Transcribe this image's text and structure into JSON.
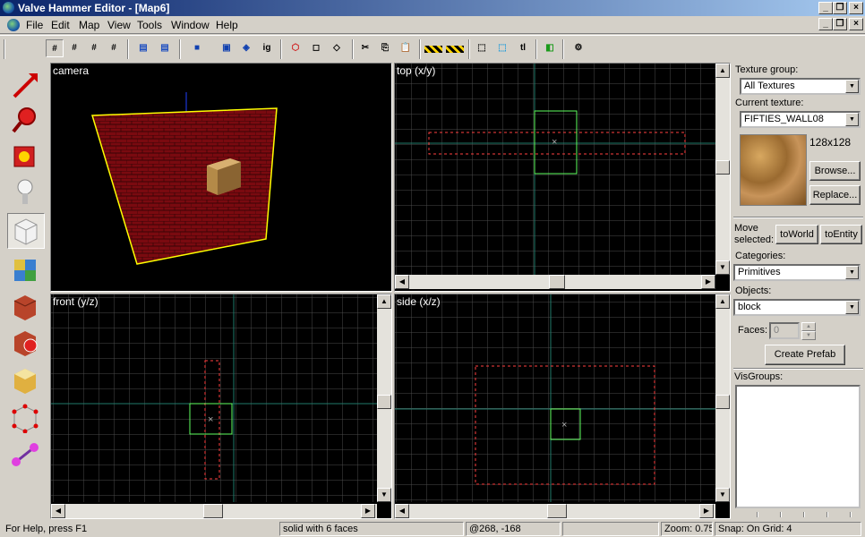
{
  "window": {
    "title": "Valve Hammer Editor - [Map6]"
  },
  "menu": [
    "File",
    "Edit",
    "Map",
    "View",
    "Tools",
    "Window",
    "Help"
  ],
  "toolbar": {
    "ig_label": "ig",
    "tl_label": "tl"
  },
  "viewports": {
    "camera": "camera",
    "top": "top (x/y)",
    "front": "front (y/z)",
    "side": "side (x/z)"
  },
  "panel": {
    "texture_group_label": "Texture group:",
    "texture_group_value": "All Textures",
    "current_texture_label": "Current texture:",
    "current_texture_value": "FIFTIES_WALL08",
    "texture_size": "128x128",
    "browse_label": "Browse...",
    "replace_label": "Replace...",
    "move_selected_label_1": "Move",
    "move_selected_label_2": "selected:",
    "to_world_label": "toWorld",
    "to_entity_label": "toEntity",
    "categories_label": "Categories:",
    "categories_value": "Primitives",
    "objects_label": "Objects:",
    "objects_value": "block",
    "faces_label": "Faces:",
    "faces_value": "0",
    "create_prefab_label": "Create Prefab",
    "visgroups_label": "VisGroups:"
  },
  "status": {
    "help": "For Help, press F1",
    "selection": "solid with 6 faces",
    "coords": "@268, -168",
    "zoom": "Zoom: 0.75",
    "snap": "Snap: On Grid: 4"
  },
  "colors": {
    "title_start": "#0a246a",
    "title_end": "#a6caf0",
    "grid": "#4a4a4a",
    "axis": "#1f7a6a",
    "selection": "#ff4040",
    "brush": "#60ff60"
  }
}
